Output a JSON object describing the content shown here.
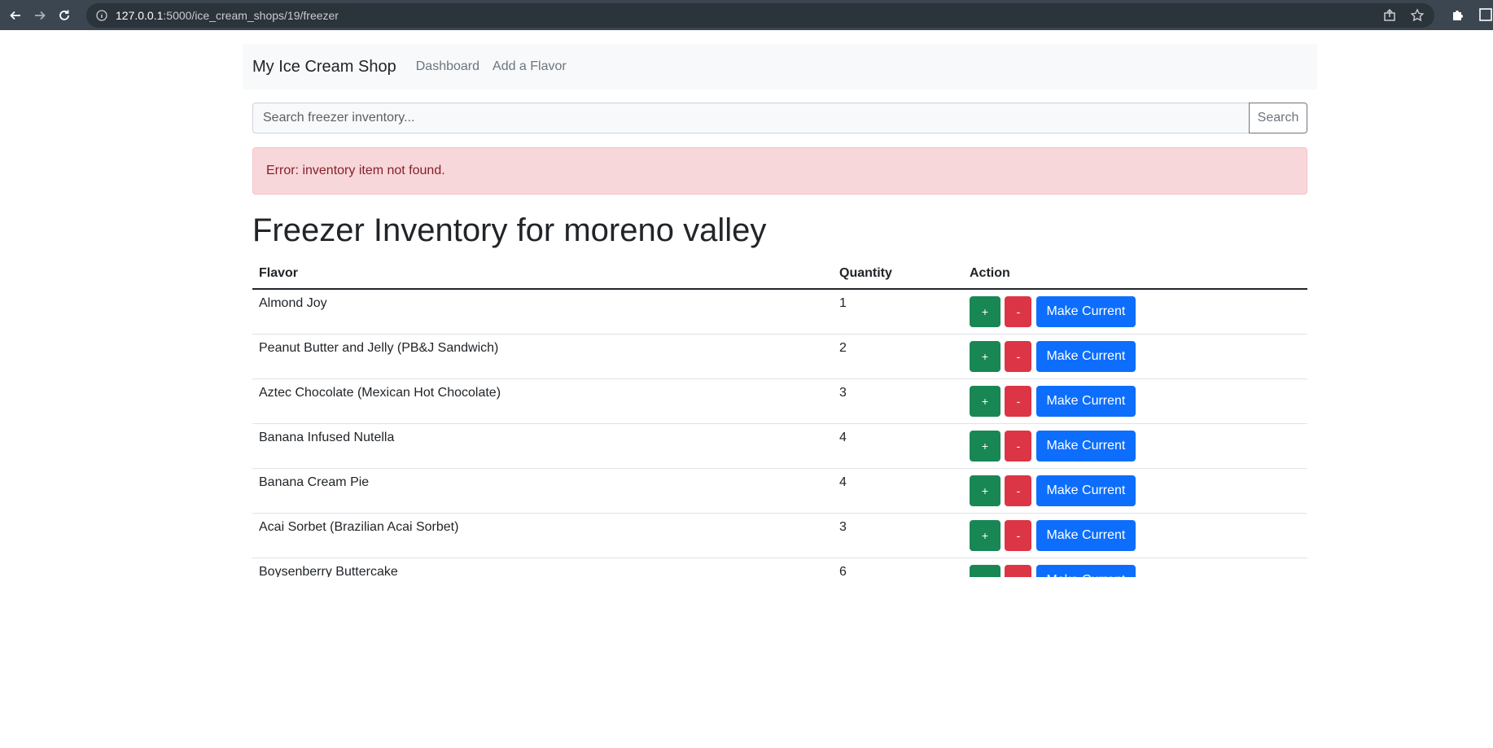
{
  "browser": {
    "url_host": "127.0.0.1",
    "url_rest": ":5000/ice_cream_shops/19/freezer"
  },
  "navbar": {
    "brand": "My Ice Cream Shop",
    "links": [
      "Dashboard",
      "Add a Flavor"
    ]
  },
  "search": {
    "placeholder": "Search freezer inventory...",
    "button_label": "Search"
  },
  "alert": {
    "message": "Error: inventory item not found."
  },
  "page_title": "Freezer Inventory for moreno valley",
  "table": {
    "headers": [
      "Flavor",
      "Quantity",
      "Action"
    ],
    "rows": [
      {
        "flavor": "Almond Joy",
        "quantity": "1"
      },
      {
        "flavor": "Peanut Butter and Jelly (PB&J Sandwich)",
        "quantity": "2"
      },
      {
        "flavor": "Aztec Chocolate (Mexican Hot Chocolate)",
        "quantity": "3"
      },
      {
        "flavor": "Banana Infused Nutella",
        "quantity": "4"
      },
      {
        "flavor": "Banana Cream Pie",
        "quantity": "4"
      },
      {
        "flavor": "Acai Sorbet (Brazilian Acai Sorbet)",
        "quantity": "3"
      },
      {
        "flavor": "Boysenberry Buttercake",
        "quantity": "6"
      }
    ],
    "actions": {
      "plus": "+",
      "minus": "-",
      "make_current": "Make Current"
    }
  },
  "colors": {
    "success": "#198754",
    "danger": "#dc3545",
    "primary": "#0d6efd",
    "alert_bg": "#f8d7da"
  }
}
